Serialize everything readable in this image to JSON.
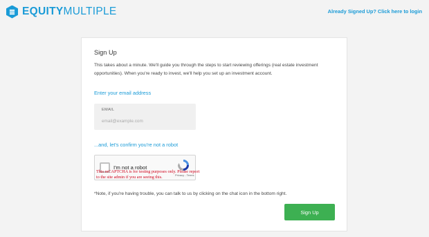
{
  "header": {
    "logo_equity": "EQUITY",
    "logo_multiple": "MULTIPLE",
    "signin_link": "Already Signed Up? Click here to login"
  },
  "form": {
    "title": "Sign Up",
    "intro": "This takes about a minute. We'll guide you through the steps to start reviewing offerings (real estate investment opportunities). When you're ready to invest, we'll help you set up an investment account.",
    "email_section_label": "Enter your email address",
    "email_field_label": "EMAIL",
    "email_placeholder": "email@example.com",
    "email_value": "",
    "robot_section_label": "...and, let's confirm you're not a robot",
    "note": "*Note, if you're having trouble, you can talk to us by clicking on the chat icon in the bottom right.",
    "submit_label": "Sign Up"
  },
  "recaptcha": {
    "checkbox_label": "I'm not a robot",
    "terms": "Privacy - Terms",
    "warning": "This reCAPTCHA is for testing purposes only. Please report to the site admin if you are seeing this."
  },
  "colors": {
    "brand_blue": "#1a9bd7",
    "button_green": "#3db052",
    "warning_red": "#d0021b"
  }
}
